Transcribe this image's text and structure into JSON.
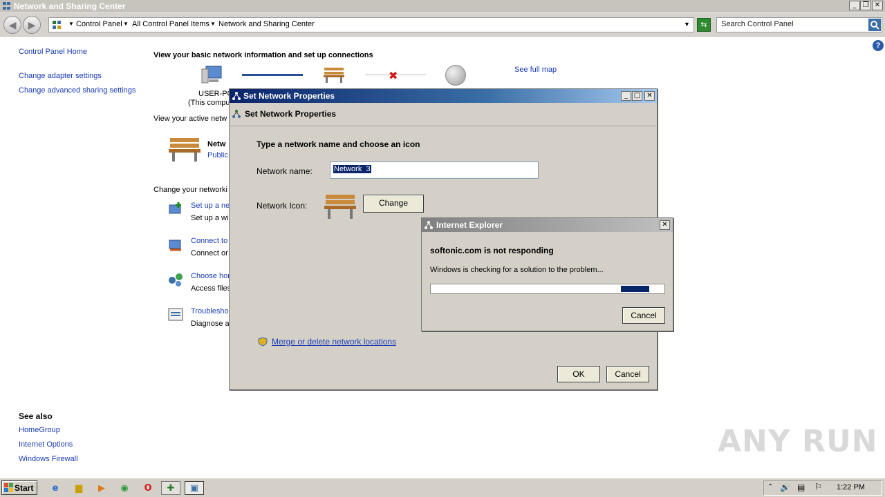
{
  "window": {
    "title": "Network and Sharing Center",
    "controls": [
      "_",
      "❐",
      "✕"
    ]
  },
  "address": {
    "crumbs": [
      "Control Panel",
      "All Control Panel Items",
      "Network and Sharing Center"
    ],
    "search_placeholder": "Search Control Panel"
  },
  "sidebar": {
    "home": "Control Panel Home",
    "items": [
      "Change adapter settings",
      "Change advanced sharing settings"
    ],
    "see_also_title": "See also",
    "see_also": [
      "HomeGroup",
      "Internet Options",
      "Windows Firewall"
    ]
  },
  "main": {
    "heading": "View your basic network information and set up connections",
    "see_full_map": "See full map",
    "computer_name": "USER-PC",
    "computer_sub": "(This compu",
    "active_label": "View your active netw",
    "network_name_partial": "Netw",
    "network_type_partial": "Public",
    "change_label": "Change your networki",
    "tasks": [
      {
        "link": "Set up a ne",
        "desc": "Set up a wi"
      },
      {
        "link": "Connect to",
        "desc": "Connect or"
      },
      {
        "link": "Choose hor",
        "desc": "Access files"
      },
      {
        "link": "Troublesho",
        "desc": "Diagnose a"
      }
    ]
  },
  "snp_dialog": {
    "title": "Set Network Properties",
    "header": "Set Network Properties",
    "prompt": "Type a network name and choose an icon",
    "name_label": "Network name:",
    "name_value": "Network  3",
    "icon_label": "Network Icon:",
    "change_button": "Change",
    "merge_link": "Merge or delete network locations",
    "ok": "OK",
    "cancel": "Cancel"
  },
  "ie_dialog": {
    "title": "Internet Explorer",
    "message": "softonic.com is not responding",
    "sub": "Windows is checking for a solution to the problem...",
    "cancel": "Cancel",
    "progress": 0.15
  },
  "taskbar": {
    "start": "Start",
    "clock": "1:22 PM"
  },
  "watermark": "ANY RUN",
  "colors": {
    "link": "#1a3bb3",
    "dialog_face": "#d4d0c8",
    "active_title": "#0a246a",
    "progress": "#0a246a"
  }
}
